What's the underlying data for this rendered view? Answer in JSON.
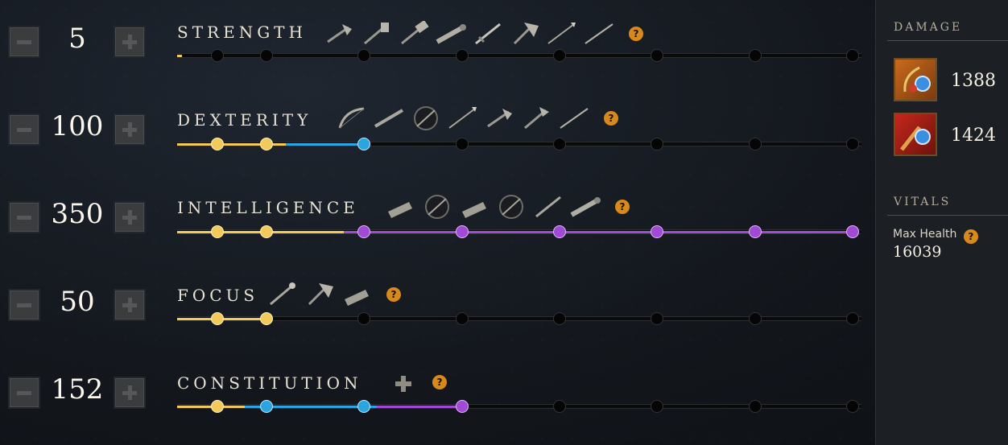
{
  "attributes": [
    {
      "name": "STRENGTH",
      "value": "5",
      "weapons": [
        "hatchet-icon",
        "war-hammer-icon",
        "hammer-icon",
        "blunderbuss-icon",
        "sword-icon",
        "great-axe-icon",
        "spear-icon",
        "rapier-icon"
      ]
    },
    {
      "name": "DEXTERITY",
      "value": "100",
      "weapons": [
        "bow-icon",
        "musket-icon",
        "ring-icon",
        "spear-icon",
        "hatchet-icon",
        "axe-icon",
        "rapier-icon"
      ]
    },
    {
      "name": "INTELLIGENCE",
      "value": "350",
      "weapons": [
        "gauntlet-icon",
        "ring-icon",
        "gauntlet-icon",
        "ring-icon",
        "staff-icon",
        "blunderbuss-icon"
      ]
    },
    {
      "name": "FOCUS",
      "value": "50",
      "weapons": [
        "life-staff-icon",
        "great-axe-icon",
        "gauntlet-icon"
      ]
    },
    {
      "name": "CONSTITUTION",
      "value": "152",
      "weapons": []
    }
  ],
  "constitution_extra_icon": "plus-icon",
  "help_glyph": "?",
  "side": {
    "damage_header": "DAMAGE",
    "damage": [
      {
        "icon": "fire-staff-weapon-icon",
        "value": "1388"
      },
      {
        "icon": "fire-gauntlet-weapon-icon",
        "value": "1424"
      }
    ],
    "vitals_header": "VITALS",
    "max_health_label": "Max Health",
    "max_health_value": "16039"
  },
  "colors": {
    "gold": "#f2c95a",
    "blue": "#2aa5e2",
    "purple": "#a14ad6",
    "help": "#d8891b"
  }
}
